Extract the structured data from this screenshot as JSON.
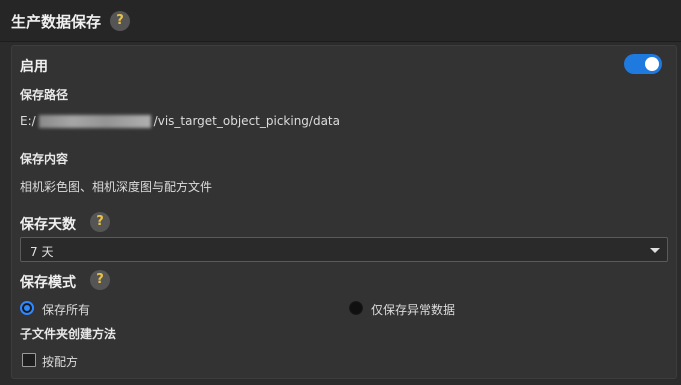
{
  "header": {
    "title": "生产数据保存",
    "help_glyph": "?"
  },
  "enable": {
    "label": "启用",
    "toggle_on": true
  },
  "save_path": {
    "label": "保存路径",
    "prefix": "E:/",
    "suffix": "/vis_target_object_picking/data"
  },
  "save_content": {
    "label": "保存内容",
    "value": "相机彩色图、相机深度图与配方文件"
  },
  "save_days": {
    "label": "保存天数",
    "help_glyph": "?",
    "selected": "7 天"
  },
  "save_mode": {
    "label": "保存模式",
    "help_glyph": "?",
    "options": [
      {
        "label": "保存所有",
        "selected": true
      },
      {
        "label": "仅保存异常数据",
        "selected": false
      }
    ]
  },
  "subfolder": {
    "label": "子文件夹创建方法",
    "option_label": "按配方",
    "checked": false
  },
  "colors": {
    "accent": "#1f7ae0",
    "help_icon": "#e8c34a",
    "background": "#2b2b2b",
    "panel": "#333333"
  }
}
